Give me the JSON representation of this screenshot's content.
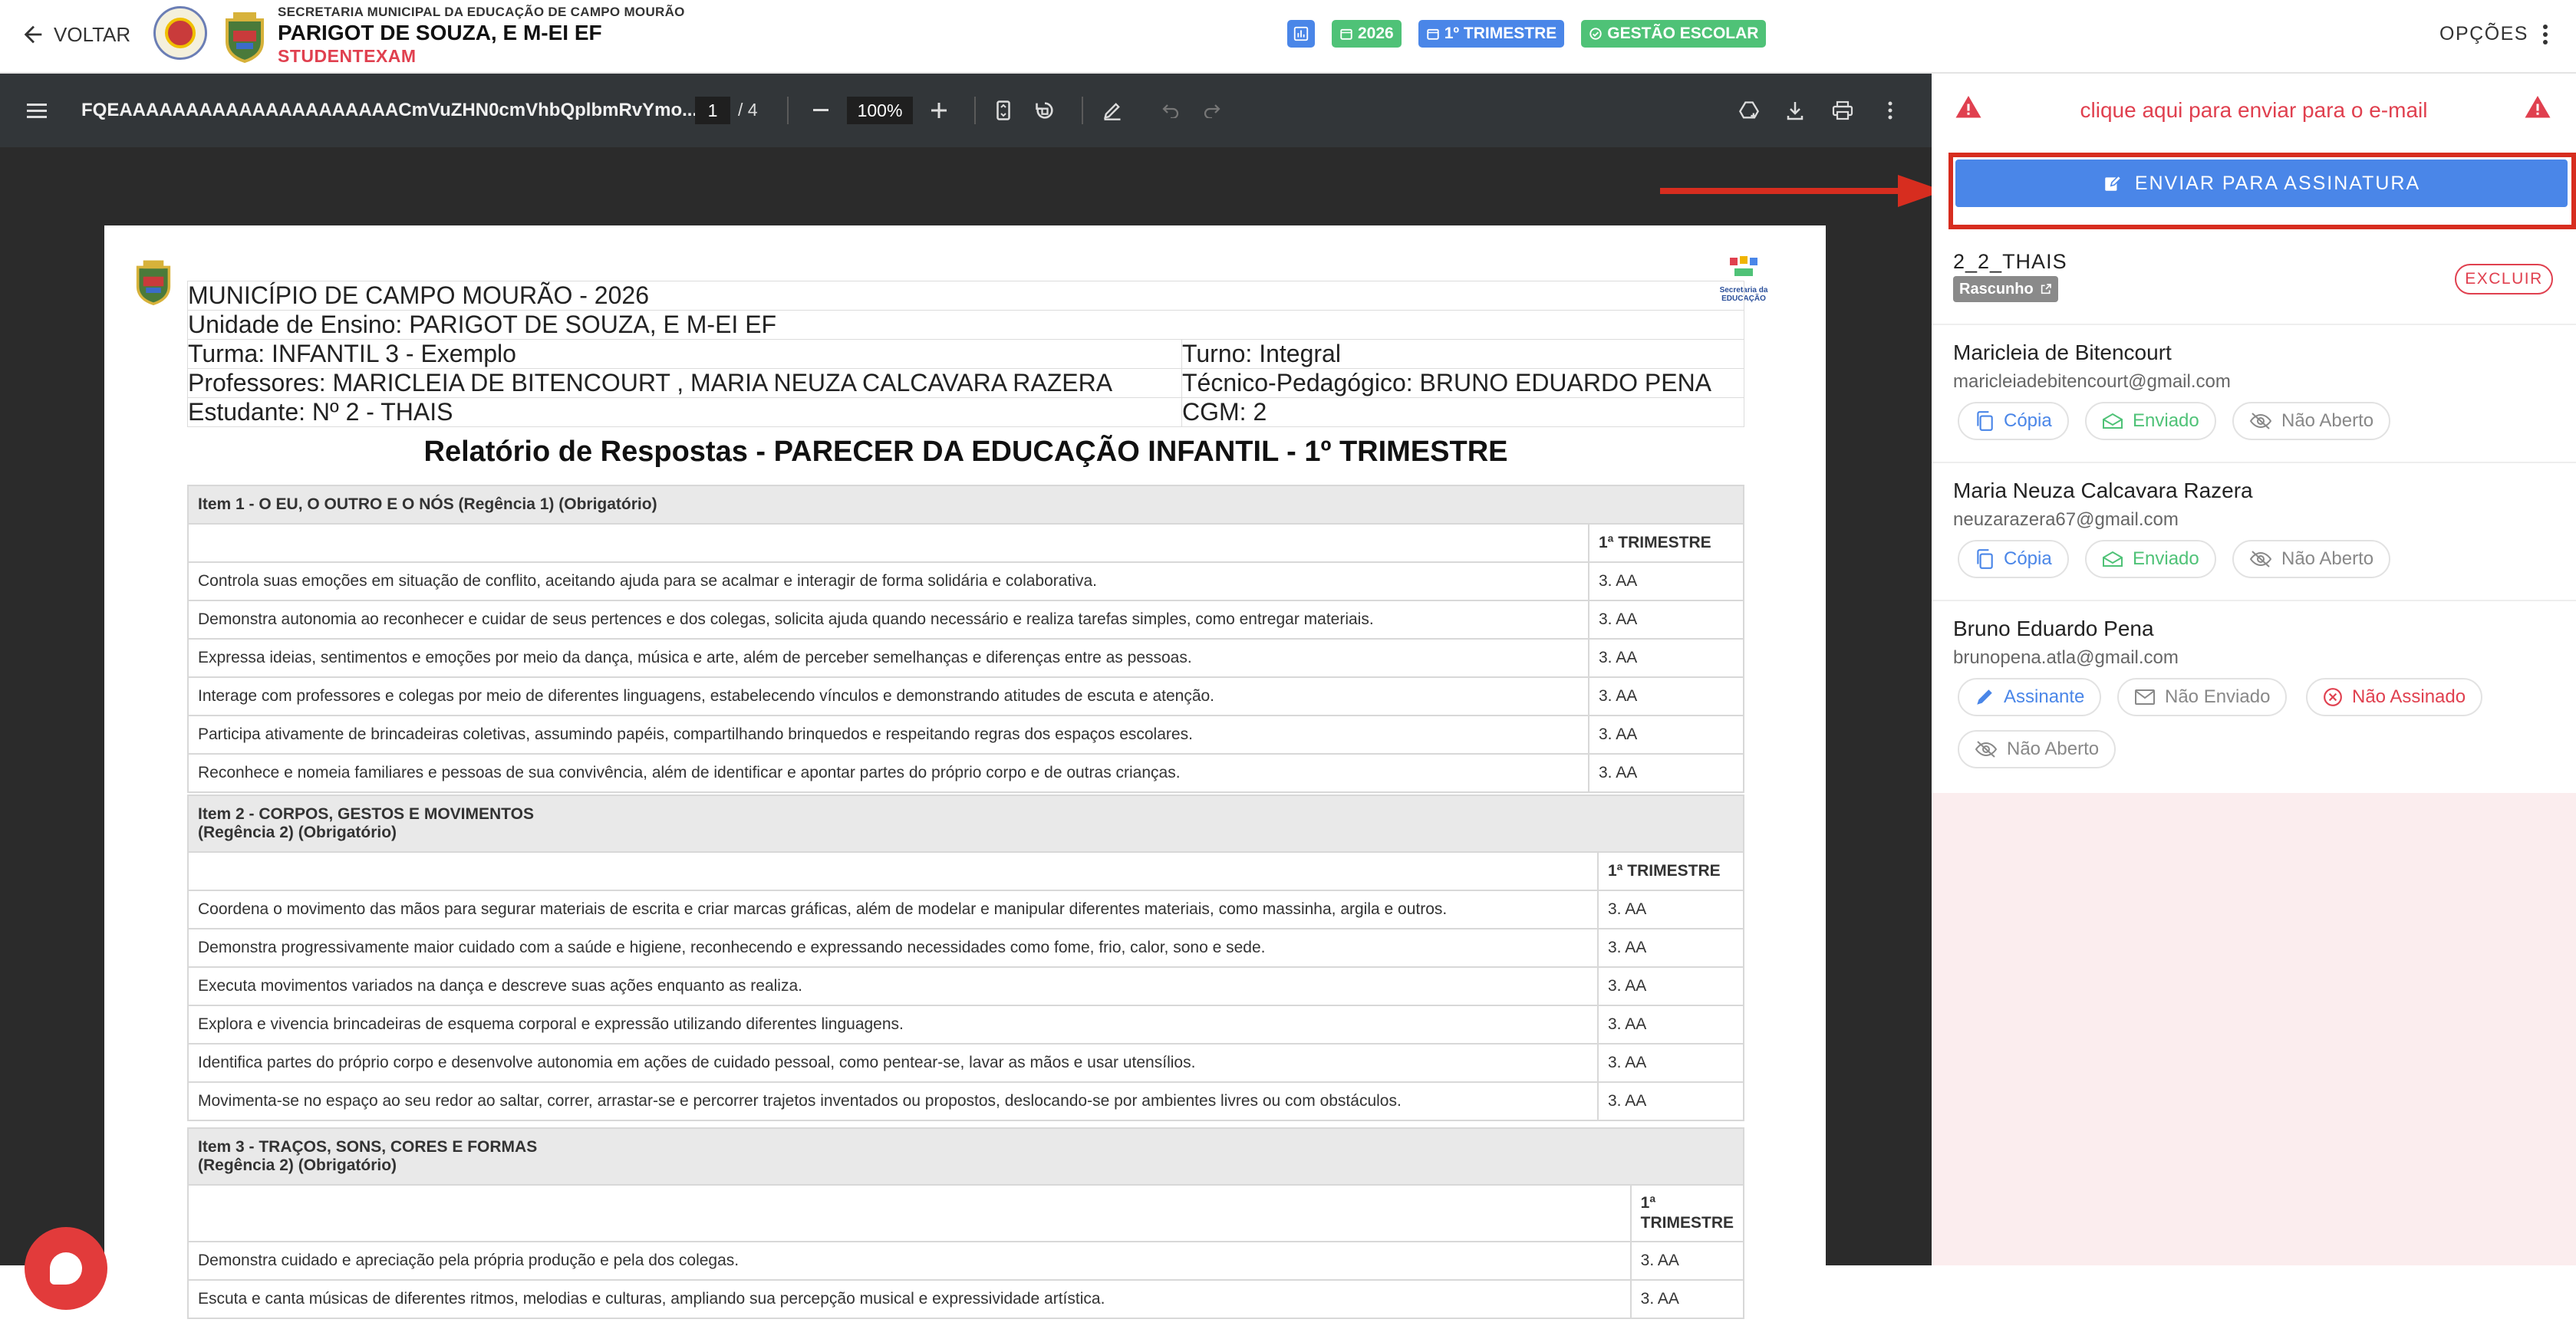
{
  "topbar": {
    "back_label": "VOLTAR",
    "secretaria": "SECRETARIA MUNICIPAL DA EDUCAÇÃO DE CAMPO MOURÃO",
    "school_name": "PARIGOT DE SOUZA, E M-EI EF",
    "app_name": "STUDENTEXAM",
    "chips": {
      "year": "2026",
      "trimester": "1º TRIMESTRE",
      "gestao": "GESTÃO ESCOLAR"
    },
    "options_label": "OPÇÕES"
  },
  "viewer": {
    "filename": "FQEAAAAAAAAAAAAAAAAAAAAACmVuZHN0cmVhbQplbmRvYmo...",
    "page_current": "1",
    "page_total": "/ 4",
    "zoom": "100%"
  },
  "document": {
    "logo_caption": "Secretaria da EDUCAÇÃO",
    "header": {
      "municipio": "MUNICÍPIO DE CAMPO MOURÃO - 2026",
      "unidade": "Unidade de Ensino: PARIGOT DE SOUZA, E M-EI EF",
      "turma": "Turma: INFANTIL 3 - Exemplo",
      "turno": "Turno: Integral",
      "professores": "Professores: MARICLEIA DE BITENCOURT , MARIA NEUZA CALCAVARA RAZERA",
      "tecnico": "Técnico-Pedagógico: BRUNO EDUARDO PENA",
      "estudante": "Estudante: Nº 2 - THAIS",
      "cgm": "CGM: 2"
    },
    "title": "Relatório de Respostas - PARECER DA EDUCAÇÃO INFANTIL - 1º TRIMESTRE",
    "items": [
      {
        "title": "Item 1 - O EU, O OUTRO E O NÓS (Regência 1) (Obrigatório)",
        "col": "1ª TRIMESTRE",
        "rows": [
          [
            "Controla suas emoções em situação de conflito, aceitando ajuda para se acalmar e interagir de forma solidária e colaborativa.",
            "3. AA"
          ],
          [
            "Demonstra autonomia ao reconhecer e cuidar de seus pertences e dos colegas, solicita ajuda quando necessário e realiza tarefas simples, como entregar materiais.",
            "3. AA"
          ],
          [
            "Expressa ideias, sentimentos e emoções por meio da dança, música e arte, além de perceber semelhanças e diferenças entre as pessoas.",
            "3. AA"
          ],
          [
            "Interage com professores e colegas por meio de diferentes linguagens, estabelecendo vínculos e demonstrando atitudes de escuta e atenção.",
            "3. AA"
          ],
          [
            "Participa ativamente de brincadeiras coletivas, assumindo papéis, compartilhando brinquedos e respeitando regras dos espaços escolares.",
            "3. AA"
          ],
          [
            "Reconhece e nomeia familiares e pessoas de sua convivência, além de identificar e apontar partes do próprio corpo e de outras crianças.",
            "3. AA"
          ]
        ]
      },
      {
        "title": "Item 2 - CORPOS, GESTOS E MOVIMENTOS",
        "title2": "(Regência 2) (Obrigatório)",
        "col": "1ª TRIMESTRE",
        "rows": [
          [
            "Coordena o movimento das mãos para segurar materiais de escrita e criar marcas gráficas, além de modelar e manipular diferentes materiais, como massinha, argila e outros.",
            "3. AA"
          ],
          [
            "Demonstra progressivamente maior cuidado com a saúde e higiene, reconhecendo e expressando necessidades como fome, frio, calor, sono e sede.",
            "3. AA"
          ],
          [
            "Executa movimentos variados na dança e descreve suas ações enquanto as realiza.",
            "3. AA"
          ],
          [
            "Explora e vivencia brincadeiras de esquema corporal e expressão utilizando diferentes linguagens.",
            "3. AA"
          ],
          [
            "Identifica partes do próprio corpo e desenvolve autonomia em ações de cuidado pessoal, como pentear-se, lavar as mãos e usar utensílios.",
            "3. AA"
          ],
          [
            "Movimenta-se no espaço ao seu redor ao saltar, correr, arrastar-se e percorrer trajetos inventados ou propostos, deslocando-se por ambientes livres ou com obstáculos.",
            "3. AA"
          ]
        ]
      },
      {
        "title": "Item 3 - TRAÇOS, SONS, CORES E FORMAS",
        "title2": "(Regência 2) (Obrigatório)",
        "col1": "1ª",
        "col2": "TRIMESTRE",
        "rows": [
          [
            "Demonstra cuidado e apreciação pela própria produção e pela dos colegas.",
            "3. AA"
          ],
          [
            "Escuta e canta músicas de diferentes ritmos, melodias e culturas, ampliando sua percepção musical e expressividade artística.",
            "3. AA"
          ]
        ]
      }
    ]
  },
  "panel": {
    "warning": "clique aqui para enviar para o e-mail",
    "send_label": "ENVIAR PARA ASSINATURA",
    "doc_name": "2_2_THAIS",
    "status": "Rascunho",
    "delete_label": "EXCLUIR",
    "people": [
      {
        "name": "Maricleia de Bitencourt",
        "email": "maricleiadebitencourt@gmail.com",
        "tags": [
          "Cópia",
          "Enviado",
          "Não Aberto"
        ]
      },
      {
        "name": "Maria Neuza Calcavara Razera",
        "email": "neuzarazera67@gmail.com",
        "tags": [
          "Cópia",
          "Enviado",
          "Não Aberto"
        ]
      },
      {
        "name": "Bruno Eduardo Pena",
        "email": "brunopena.atla@gmail.com",
        "tags": [
          "Assinante",
          "Não Enviado",
          "Não Assinado",
          "Não Aberto"
        ]
      }
    ]
  },
  "colors": {
    "accent": "#4a86e8",
    "success": "#4fc277",
    "danger": "#e0404f",
    "highlight": "#d72d1f"
  }
}
